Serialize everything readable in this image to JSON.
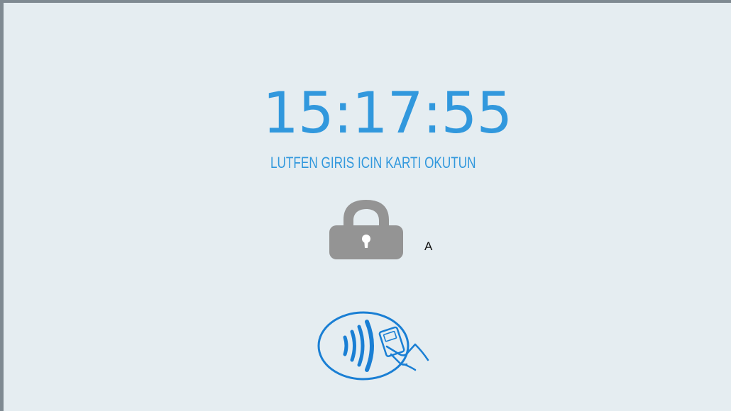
{
  "clock": {
    "time": "15:17:55"
  },
  "prompt": {
    "text": "LUTFEN GIRIS ICIN KARTI OKUTUN"
  },
  "status": {
    "letter": "A"
  },
  "icons": {
    "lock": "lock-icon",
    "card_reader": "contactless-card-icon"
  },
  "colors": {
    "accent": "#3198dd",
    "background": "#e5edf1",
    "lock": "#949494",
    "nfc": "#1a7fd4"
  }
}
